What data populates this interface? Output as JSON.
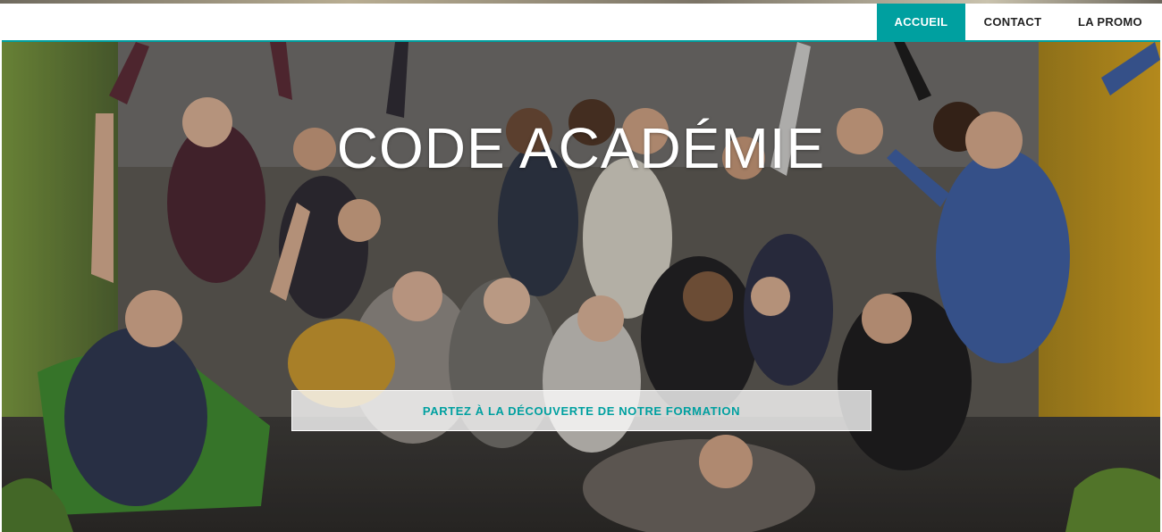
{
  "nav": {
    "items": [
      {
        "label": "ACCUEIL",
        "active": true
      },
      {
        "label": "CONTACT",
        "active": false
      },
      {
        "label": "LA PROMO",
        "active": false
      }
    ]
  },
  "hero": {
    "title": "CODE ACADÉMIE",
    "cta_label": "PARTEZ À LA DÉCOUVERTE DE NOTRE FORMATION"
  },
  "colors": {
    "accent": "#00a0a0",
    "nav_bg": "#ffffff",
    "nav_text": "#222222",
    "hero_text": "#ffffff"
  }
}
